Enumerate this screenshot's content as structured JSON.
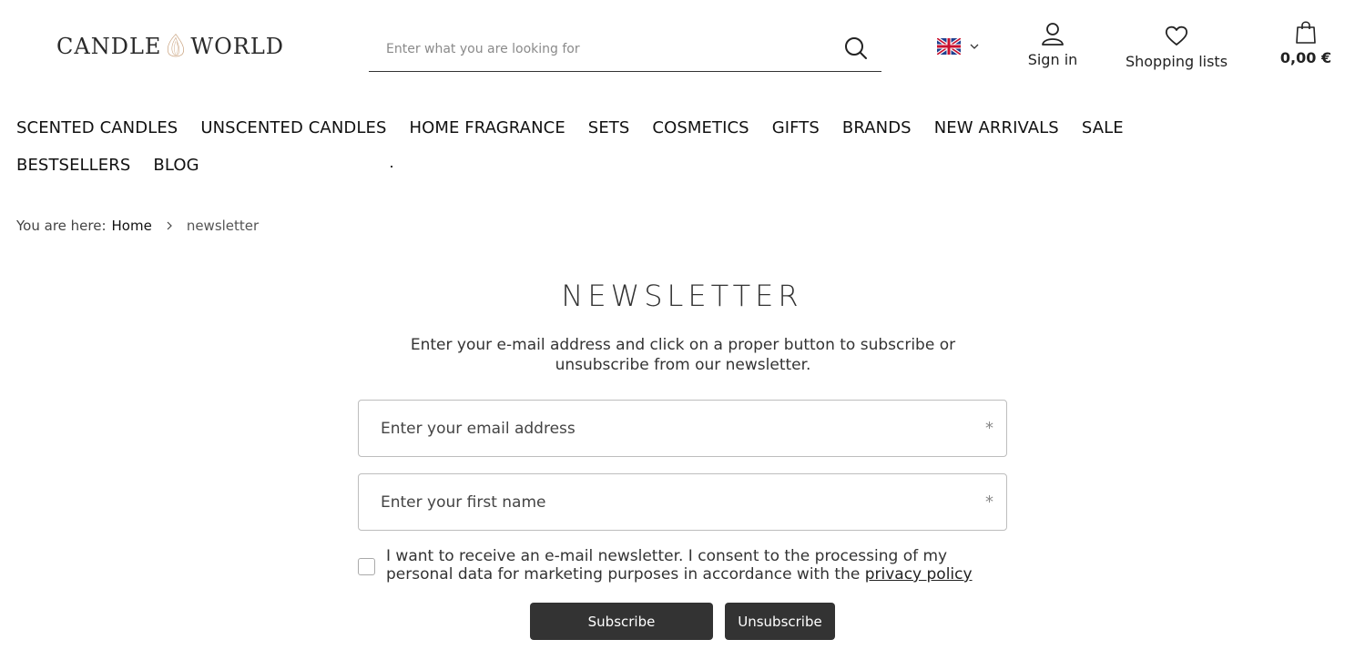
{
  "header": {
    "logo_left": "CANDLE",
    "logo_right": "WORLD",
    "search_placeholder": "Enter what you are looking for",
    "signin_label": "Sign in",
    "lists_label": "Shopping lists",
    "cart_total": "0,00 €"
  },
  "nav": {
    "row1": [
      "SCENTED CANDLES",
      "UNSCENTED CANDLES",
      "HOME FRAGRANCE",
      "SETS",
      "COSMETICS",
      "GIFTS",
      "BRANDS",
      "NEW ARRIVALS",
      "SALE"
    ],
    "row2": [
      "BESTSELLERS",
      "BLOG"
    ]
  },
  "breadcrumb": {
    "prefix": "You are here:",
    "home": "Home",
    "current": "newsletter"
  },
  "main": {
    "title": "NEWSLETTER",
    "intro": "Enter your e-mail address and click on a proper button to subscribe or unsubscribe from our newsletter.",
    "email_placeholder": "Enter your email address",
    "name_placeholder": "Enter your first name",
    "required_mark": "*",
    "consent_text": "I want to receive an e-mail newsletter. I consent to the processing of my personal data for marketing purposes in accordance with the",
    "consent_link": "privacy policy",
    "subscribe_label": "Subscribe",
    "unsubscribe_label": "Unsubscribe"
  },
  "icons": {
    "search": "search-icon",
    "user": "user-icon",
    "heart": "heart-icon",
    "bag": "shopping-bag-icon",
    "flag": "uk-flag-icon",
    "chevron": "chevron-down-icon"
  },
  "colors": {
    "button_bg": "#333333",
    "logo_accent": "#c9a27e"
  }
}
